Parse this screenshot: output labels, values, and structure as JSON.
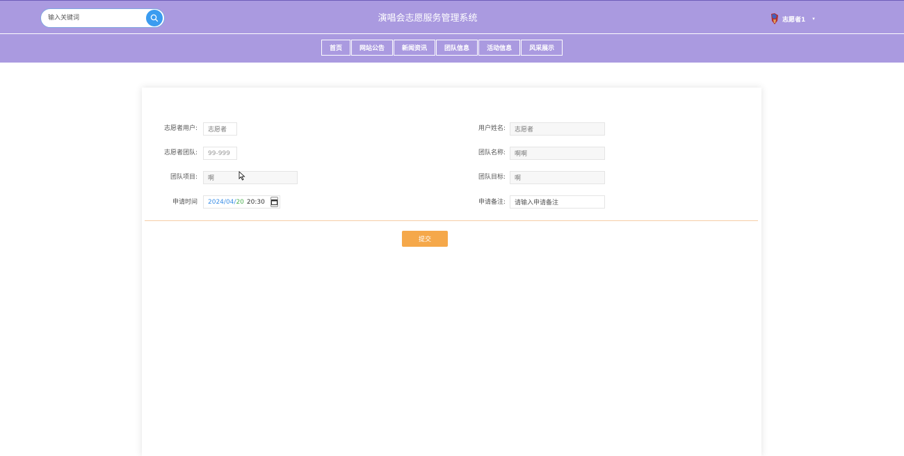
{
  "header": {
    "title": "演唱会志愿服务管理系统",
    "search_placeholder": "输入关键词",
    "user_name": "志愿者1",
    "caret": "▾"
  },
  "nav": {
    "items": [
      {
        "label": "首页"
      },
      {
        "label": "网站公告"
      },
      {
        "label": "新闻资讯"
      },
      {
        "label": "团队信息"
      },
      {
        "label": "活动信息"
      },
      {
        "label": "风采展示"
      }
    ]
  },
  "form": {
    "volunteer_user": {
      "label": "志愿者用户:",
      "value": "志愿者"
    },
    "user_realname": {
      "label": "用户姓名:",
      "value": "志愿者"
    },
    "volunteer_team": {
      "label": "志愿者团队:",
      "value": "99-999"
    },
    "team_name": {
      "label": "团队名称:",
      "value": "啊啊"
    },
    "team_project": {
      "label": "团队项目:",
      "value": "啊"
    },
    "team_goal": {
      "label": "团队目标:",
      "value": "啊"
    },
    "apply_time": {
      "label": "申请时间",
      "year": "2024",
      "sep": "/",
      "month": "04",
      "day": "20",
      "time": "20:30"
    },
    "apply_note": {
      "label": "申请备注:",
      "placeholder": "请输入申请备注"
    },
    "submit_label": "提交"
  },
  "colors": {
    "header_bg": "#aa9ae0",
    "submit_bg": "#f5a84a",
    "search_btn": "#3a9cf0"
  }
}
